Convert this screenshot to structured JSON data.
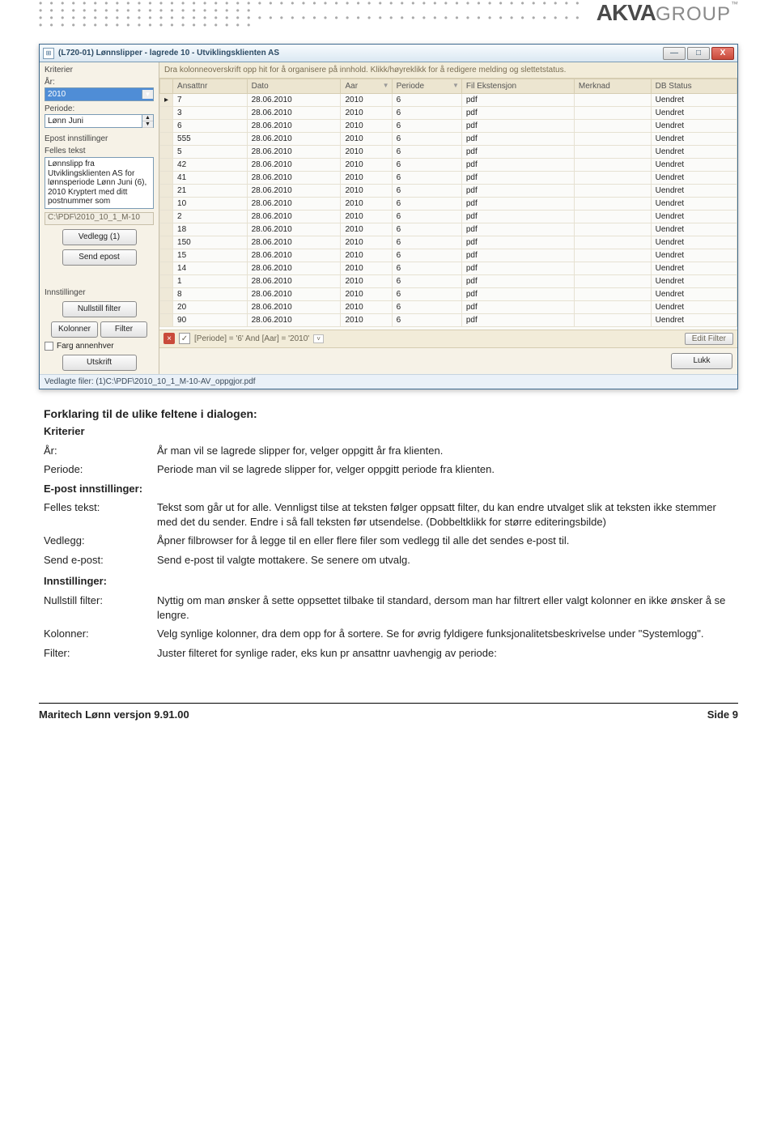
{
  "header": {
    "logo_bold": "AKVA",
    "logo_light": "GROUP",
    "tm": "™"
  },
  "window": {
    "title": "(L720-01) Lønnslipper - lagrede 10 - Utviklingsklienten AS",
    "minimize_glyph": "—",
    "maximize_glyph": "□",
    "close_glyph": "X",
    "group_hint": "Dra kolonneoverskrift opp hit for å organisere på innhold. Klikk/høyreklikk for å redigere melding og slettetstatus.",
    "sidebar": {
      "kriterier_hdr": "Kriterier",
      "ar_label": "År:",
      "ar_value": "2010",
      "periode_label": "Periode:",
      "periode_value": "Lønn Juni",
      "epost_hdr": "Epost innstillinger",
      "felles_label": "Felles tekst",
      "felles_text": "Lønnslipp fra Utviklingsklienten AS for lønnsperiode Lønn Juni (6), 2010\nKryptert med ditt postnummer som",
      "path_value": "C:\\PDF\\2010_10_1_M-10",
      "vedlegg_btn": "Vedlegg (1)",
      "send_btn": "Send epost",
      "innst_hdr": "Innstillinger",
      "nullstill_btn": "Nullstill filter",
      "kolonner_btn": "Kolonner",
      "filter_btn": "Filter",
      "farg_chk": "Farg annenhver",
      "utskrift_btn": "Utskrift"
    },
    "columns": [
      "Ansattnr",
      "Dato",
      "Aar",
      "Periode",
      "Fil Ekstensjon",
      "Merknad",
      "DB Status"
    ],
    "rows": [
      {
        "ansattnr": "7",
        "dato": "28.06.2010",
        "aar": "2010",
        "periode": "6",
        "ext": "pdf",
        "merk": "",
        "status": "Uendret"
      },
      {
        "ansattnr": "3",
        "dato": "28.06.2010",
        "aar": "2010",
        "periode": "6",
        "ext": "pdf",
        "merk": "",
        "status": "Uendret"
      },
      {
        "ansattnr": "6",
        "dato": "28.06.2010",
        "aar": "2010",
        "periode": "6",
        "ext": "pdf",
        "merk": "",
        "status": "Uendret"
      },
      {
        "ansattnr": "555",
        "dato": "28.06.2010",
        "aar": "2010",
        "periode": "6",
        "ext": "pdf",
        "merk": "",
        "status": "Uendret"
      },
      {
        "ansattnr": "5",
        "dato": "28.06.2010",
        "aar": "2010",
        "periode": "6",
        "ext": "pdf",
        "merk": "",
        "status": "Uendret"
      },
      {
        "ansattnr": "42",
        "dato": "28.06.2010",
        "aar": "2010",
        "periode": "6",
        "ext": "pdf",
        "merk": "",
        "status": "Uendret"
      },
      {
        "ansattnr": "41",
        "dato": "28.06.2010",
        "aar": "2010",
        "periode": "6",
        "ext": "pdf",
        "merk": "",
        "status": "Uendret"
      },
      {
        "ansattnr": "21",
        "dato": "28.06.2010",
        "aar": "2010",
        "periode": "6",
        "ext": "pdf",
        "merk": "",
        "status": "Uendret"
      },
      {
        "ansattnr": "10",
        "dato": "28.06.2010",
        "aar": "2010",
        "periode": "6",
        "ext": "pdf",
        "merk": "",
        "status": "Uendret"
      },
      {
        "ansattnr": "2",
        "dato": "28.06.2010",
        "aar": "2010",
        "periode": "6",
        "ext": "pdf",
        "merk": "",
        "status": "Uendret"
      },
      {
        "ansattnr": "18",
        "dato": "28.06.2010",
        "aar": "2010",
        "periode": "6",
        "ext": "pdf",
        "merk": "",
        "status": "Uendret"
      },
      {
        "ansattnr": "150",
        "dato": "28.06.2010",
        "aar": "2010",
        "periode": "6",
        "ext": "pdf",
        "merk": "",
        "status": "Uendret"
      },
      {
        "ansattnr": "15",
        "dato": "28.06.2010",
        "aar": "2010",
        "periode": "6",
        "ext": "pdf",
        "merk": "",
        "status": "Uendret"
      },
      {
        "ansattnr": "14",
        "dato": "28.06.2010",
        "aar": "2010",
        "periode": "6",
        "ext": "pdf",
        "merk": "",
        "status": "Uendret"
      },
      {
        "ansattnr": "1",
        "dato": "28.06.2010",
        "aar": "2010",
        "periode": "6",
        "ext": "pdf",
        "merk": "",
        "status": "Uendret"
      },
      {
        "ansattnr": "8",
        "dato": "28.06.2010",
        "aar": "2010",
        "periode": "6",
        "ext": "pdf",
        "merk": "",
        "status": "Uendret"
      },
      {
        "ansattnr": "20",
        "dato": "28.06.2010",
        "aar": "2010",
        "periode": "6",
        "ext": "pdf",
        "merk": "",
        "status": "Uendret"
      },
      {
        "ansattnr": "90",
        "dato": "28.06.2010",
        "aar": "2010",
        "periode": "6",
        "ext": "pdf",
        "merk": "",
        "status": "Uendret"
      }
    ],
    "filter_expr": "[Periode] = '6' And [Aar] = '2010'",
    "edit_filter": "Edit Filter",
    "lukk_btn": "Lukk",
    "statusbar": "Vedlagte filer: (1)C:\\PDF\\2010_10_1_M-10-AV_oppgjor.pdf"
  },
  "explain": {
    "heading": "Forklaring til de ulike feltene i dialogen:",
    "kriterier_hdr": "Kriterier",
    "ar_lbl": "År:",
    "ar_txt": "År man vil se lagrede slipper for, velger oppgitt år fra klienten.",
    "periode_lbl": "Periode:",
    "periode_txt": "Periode man vil se lagrede slipper for, velger oppgitt periode fra klienten.",
    "epost_lbl": "E-post innstillinger:",
    "felles_lbl": "Felles tekst:",
    "felles_txt": "Tekst som går ut for alle. Vennligst tilse at teksten følger oppsatt filter, du kan endre utvalget slik at teksten ikke stemmer med det du sender. Endre i så fall teksten før utsendelse. (Dobbeltklikk for større editeringsbilde)",
    "vedlegg_lbl": "Vedlegg:",
    "vedlegg_txt": "Åpner filbrowser for å legge til en eller flere filer som vedlegg til alle det sendes e-post til.",
    "send_lbl": "Send e-post:",
    "send_txt": "Send e-post til valgte mottakere. Se senere om utvalg.",
    "innst_hdr": "Innstillinger:",
    "nullstill_lbl": "Nullstill filter:",
    "nullstill_txt": "Nyttig om man ønsker å sette oppsettet tilbake til standard, dersom man har filtrert eller valgt kolonner en ikke ønsker å se lengre.",
    "kolonner_lbl": "Kolonner:",
    "kolonner_txt": "Velg synlige kolonner, dra dem opp for å sortere. Se for øvrig fyldigere funksjonalitetsbeskrivelse under \"Systemlogg\".",
    "filter_lbl": "Filter:",
    "filter_txt": "Juster filteret for synlige rader, eks kun pr ansattnr uavhengig av periode:"
  },
  "footer": {
    "left": "Maritech Lønn versjon 9.91.00",
    "right": "Side 9"
  }
}
